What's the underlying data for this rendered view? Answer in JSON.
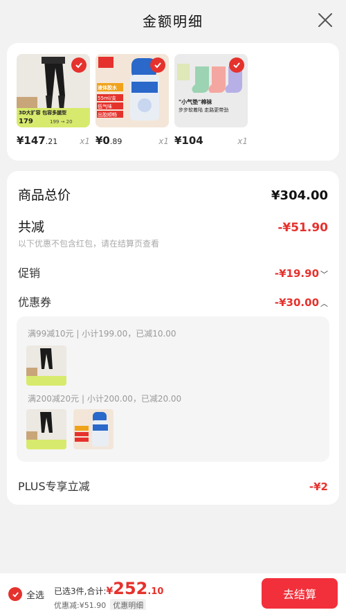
{
  "header": {
    "title": "金额明细"
  },
  "products": [
    {
      "price_int": "¥147",
      "price_dec": ".21",
      "qty": "x1",
      "img_text1": "3D大扩容 包容多腿型",
      "img_price": "179",
      "img_price2": "199 → 20"
    },
    {
      "price_int": "¥0",
      "price_dec": ".89",
      "qty": "x1",
      "img_text1": "液体胶水",
      "img_text2": "55ml/支",
      "img_text3": "低气味",
      "img_text4": "出胶顺畅"
    },
    {
      "price_int": "¥104",
      "price_dec": "",
      "qty": "x1",
      "img_text1": "\"小气垫\"棉袜",
      "img_text2": "步步软着陆 走路更带劲"
    }
  ],
  "detail": {
    "goods_total_label": "商品总价",
    "goods_total_value": "¥304.00",
    "discount_label": "共减",
    "discount_value": "-¥51.90",
    "discount_note": "以下优惠不包含红包，请在结算页查看",
    "promo_label": "促销",
    "promo_value": "-¥19.90",
    "coupon_label": "优惠券",
    "coupon_value": "-¥30.00",
    "coupon_line1": "满99减10元 | 小计199.00，已减10.00",
    "coupon_line2": "满200减20元 | 小计200.00，已减20.00",
    "plus_label": "PLUS专享立减",
    "plus_value": "-¥2"
  },
  "bottom": {
    "select_all": "全选",
    "selected_text": "已选3件,合计:",
    "currency": "¥",
    "total_int": "252",
    "total_dec": ".10",
    "saved_text": "优惠减:¥51.90",
    "detail_tag": "优惠明细",
    "checkout": "去结算"
  },
  "colors": {
    "accent": "#e5322d",
    "checkout_bg": "#f2303b"
  }
}
